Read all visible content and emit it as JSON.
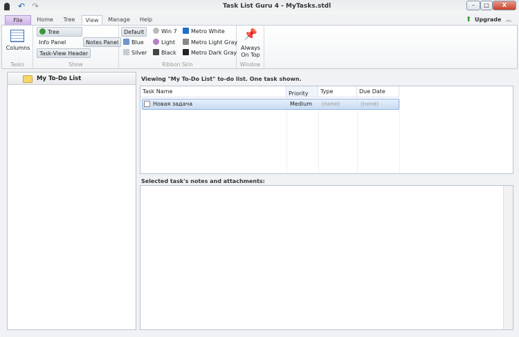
{
  "window": {
    "title": "Task List Guru 4 - MyTasks.stdl",
    "minimize": "–",
    "maximize": "□",
    "close": "X"
  },
  "ribbon_tabs": [
    "File",
    "Home",
    "Tree",
    "View",
    "Manage",
    "Help"
  ],
  "upgrade": "Upgrade",
  "groups": {
    "tasks": {
      "label": "Tasks",
      "columns": "Columns"
    },
    "show": {
      "label": "Show",
      "tree": "Tree",
      "info_panel": "Info Panel",
      "notes_panel": "Notes Panel",
      "task_view_header": "Task-View Header"
    },
    "skin": {
      "label": "Ribbon Skin",
      "items": [
        "Default",
        "Blue",
        "Silver",
        "Win 7",
        "Light",
        "Black",
        "Metro White",
        "Metro Light Gray",
        "Metro Dark Gray"
      ]
    },
    "window": {
      "label": "Window",
      "always_on_top_1": "Always",
      "always_on_top_2": "On Top"
    }
  },
  "tree": {
    "root": "My To-Do List"
  },
  "main": {
    "viewing": "Viewing \"My To-Do List\" to-do list. One task shown.",
    "columns": [
      "Task Name",
      "Priority",
      "Type",
      "Due Date"
    ],
    "rows": [
      {
        "name": "Новая задача",
        "priority": "Medium",
        "type": "(none)",
        "due": "(none)",
        "checked": false
      }
    ],
    "notes_label": "Selected task's notes and attachments:"
  }
}
